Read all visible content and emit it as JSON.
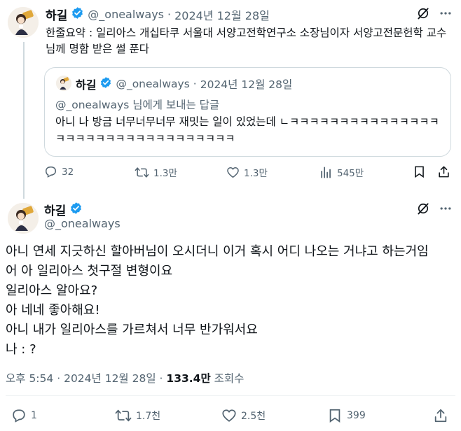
{
  "parent_tweet": {
    "author_name": "하길",
    "handle": "@_onealways",
    "date": "2024년 12월 28일",
    "separator": "·",
    "text": "한줄요약 : 일리아스 개십타쿠 서울대 서양고전학연구소 소장님이자 서양고전문헌학 교수님께 명함 받은 썰 푼다",
    "quote": {
      "author_name": "하길",
      "handle": "@_onealways",
      "date": "2024년 12월 28일",
      "separator": "·",
      "reply_to": "@_onealways 님에게 보내는 답글",
      "text": "아니 나 방금 너무너무너무 재밋는 일이 있었는데 ㄴㅋㅋㅋㅋㅋㅋㅋㅋㅋㅋㅋㅋㅋㅋㅋㅋㅋㅋㅋㅋㅋㅋㅋㅋㅋㅋㅋㅋㅋㅋㅋㅋㅋ"
    },
    "actions": {
      "replies": "32",
      "retweets": "1.3만",
      "likes": "1.3만",
      "views": "545만"
    }
  },
  "main_tweet": {
    "author_name": "하길",
    "handle": "@_onealways",
    "text": "아니 연세 지긋하신 할아버님이 오시더니 이거 혹시 어디 나오는 거냐고 하는거임\n어 아 일리아스 첫구절 변형이요\n일리아스 알아요?\n아 네네 좋아해요!\n아니 내가 일리아스를 가르쳐서 너무 반가워서요\n나 : ?",
    "time": "오후 5:54",
    "date": "2024년 12월 28일",
    "separator": "·",
    "view_count": "133.4만",
    "view_label": "조회수",
    "actions": {
      "replies": "1",
      "retweets": "1.7천",
      "likes": "2.5천",
      "bookmarks": "399"
    }
  },
  "colors": {
    "verified": "#1d9bf0",
    "secondary_text": "#536471",
    "border": "#cfd9de"
  },
  "icons": [
    "grok-icon",
    "more-icon",
    "verified-icon",
    "reply-icon",
    "retweet-icon",
    "like-icon",
    "views-icon",
    "bookmark-icon",
    "share-icon"
  ]
}
